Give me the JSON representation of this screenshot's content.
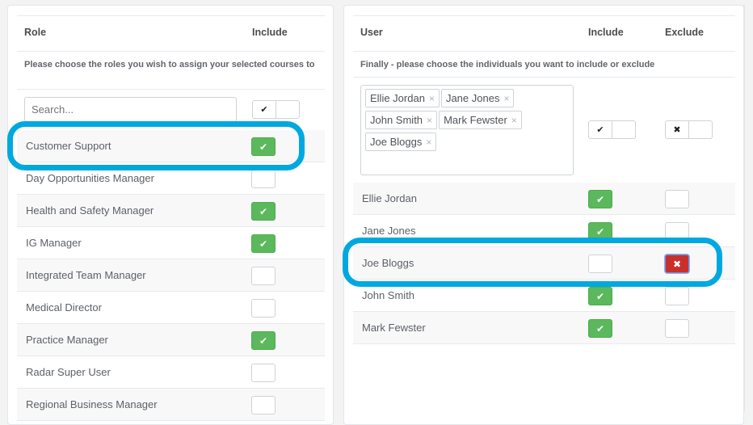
{
  "roles_panel": {
    "header": {
      "role": "Role",
      "include": "Include"
    },
    "instruction": "Please choose the roles you wish to assign your selected courses to",
    "search": {
      "placeholder": "Search...",
      "value": ""
    },
    "bulk_include_icon": "check-icon",
    "rows": [
      {
        "label": "Customer Support",
        "include": true
      },
      {
        "label": "Day Opportunities Manager",
        "include": false
      },
      {
        "label": "Health and Safety Manager",
        "include": true
      },
      {
        "label": "IG Manager",
        "include": true
      },
      {
        "label": "Integrated Team Manager",
        "include": false
      },
      {
        "label": "Medical Director",
        "include": false
      },
      {
        "label": "Practice Manager",
        "include": true
      },
      {
        "label": "Radar Super User",
        "include": false
      },
      {
        "label": "Regional Business Manager",
        "include": false
      }
    ]
  },
  "users_panel": {
    "header": {
      "user": "User",
      "include": "Include",
      "exclude": "Exclude"
    },
    "instruction": "Finally - please choose the individuals you want to include or exclude",
    "selected_tags": [
      "Ellie Jordan",
      "Jane Jones",
      "John Smith",
      "Mark Fewster",
      "Joe Bloggs"
    ],
    "tag_remove_glyph": "×",
    "bulk_include_icon": "check-icon",
    "bulk_exclude_icon": "x-icon",
    "rows": [
      {
        "label": "Ellie Jordan",
        "include": true,
        "exclude": false
      },
      {
        "label": "Jane Jones",
        "include": true,
        "exclude": false
      },
      {
        "label": "Joe Bloggs",
        "include": false,
        "exclude": true
      },
      {
        "label": "John Smith",
        "include": true,
        "exclude": false
      },
      {
        "label": "Mark Fewster",
        "include": true,
        "exclude": false
      }
    ]
  },
  "glyphs": {
    "check": "✔",
    "cross": "✖"
  },
  "colors": {
    "include_on": "#5cb85c",
    "exclude_on": "#c9302c",
    "highlight": "#00a8e0"
  }
}
